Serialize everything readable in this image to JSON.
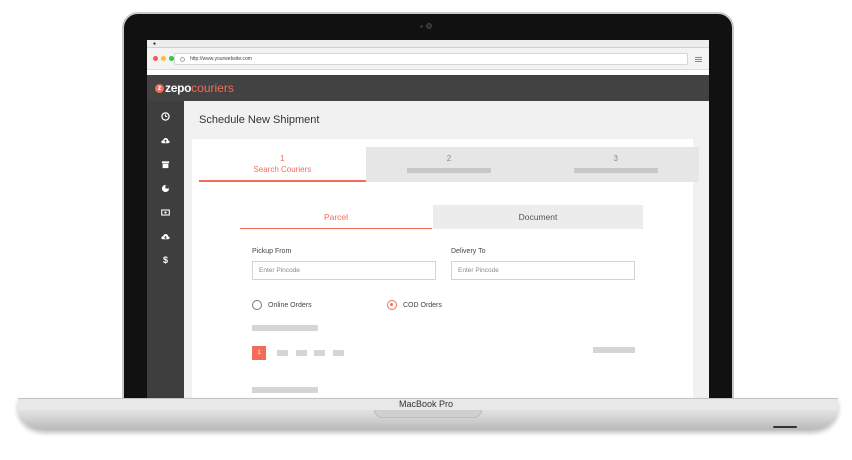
{
  "device": {
    "label": "MacBook Pro"
  },
  "browser": {
    "url": "http://www.yourwebsite.com"
  },
  "app": {
    "logo_letter": "z",
    "logo_primary": "zepo",
    "logo_secondary": "couriers"
  },
  "sidebar": {
    "items": [
      {
        "icon": "dashboard-icon"
      },
      {
        "icon": "cloud-upload-icon"
      },
      {
        "icon": "archive-icon"
      },
      {
        "icon": "pie-chart-icon"
      },
      {
        "icon": "cash-icon"
      },
      {
        "icon": "cloud-icon"
      },
      {
        "icon": "dollar-icon",
        "glyph": "$"
      }
    ]
  },
  "page": {
    "title": "Schedule New Shipment"
  },
  "steps": [
    {
      "number": "1",
      "label": "Search Couriers",
      "active": true
    },
    {
      "number": "2",
      "label": "",
      "active": false
    },
    {
      "number": "3",
      "label": "",
      "active": false
    }
  ],
  "shipment_tabs": {
    "parcel": "Parcel",
    "document": "Document"
  },
  "form": {
    "pickup": {
      "label": "Pickup From",
      "placeholder": "Enter Pincode"
    },
    "delivery": {
      "label": "Delivery To",
      "placeholder": "Enter Pincode"
    }
  },
  "order_type": {
    "online": {
      "label": "Online Orders",
      "selected": false
    },
    "cod": {
      "label": "COD Orders",
      "selected": true
    }
  },
  "pagination": {
    "current": "1"
  },
  "colors": {
    "accent": "#f26c59",
    "sidebar": "#3e3e3e",
    "header": "#424242"
  }
}
